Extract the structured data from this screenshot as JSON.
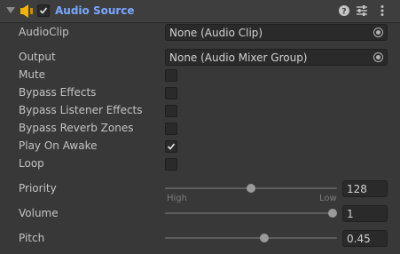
{
  "component": {
    "title": "Audio Source",
    "enabled": true,
    "icons": [
      "foldout-arrow-icon",
      "speaker-icon",
      "help-icon",
      "preset-icon",
      "context-menu-icon"
    ]
  },
  "fields": {
    "audio_clip": {
      "label": "AudioClip",
      "value": "None (Audio Clip)"
    },
    "output": {
      "label": "Output",
      "value": "None (Audio Mixer Group)"
    },
    "mute": {
      "label": "Mute",
      "checked": false
    },
    "bypass_effects": {
      "label": "Bypass Effects",
      "checked": false
    },
    "bypass_listener_effects": {
      "label": "Bypass Listener Effects",
      "checked": false
    },
    "bypass_reverb_zones": {
      "label": "Bypass Reverb Zones",
      "checked": false
    },
    "play_on_awake": {
      "label": "Play On Awake",
      "checked": true
    },
    "loop": {
      "label": "Loop",
      "checked": false
    },
    "priority": {
      "label": "Priority",
      "value": "128",
      "fraction": 0.5,
      "min_caption": "High",
      "max_caption": "Low"
    },
    "volume": {
      "label": "Volume",
      "value": "1",
      "fraction": 1.0
    },
    "pitch": {
      "label": "Pitch",
      "value": "0.45",
      "fraction": 0.58
    }
  },
  "colors": {
    "panel_bg": "#383838",
    "header_bg": "#3e3e3e",
    "title": "#7aa8ff",
    "speaker": "#f2b200",
    "field_bg": "#2a2a2a"
  }
}
